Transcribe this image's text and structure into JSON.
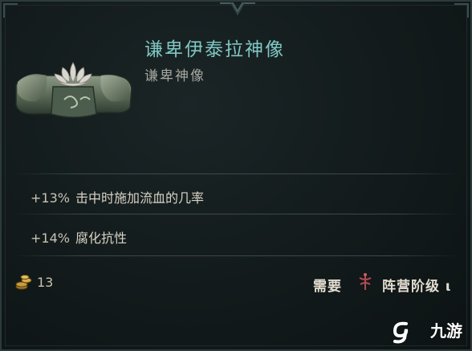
{
  "item": {
    "title": "谦卑伊泰拉神像",
    "subtitle": "谦卑神像",
    "icon": "lotus-statue-icon"
  },
  "stats": [
    {
      "value": "+13%",
      "text": "击中时施加流血的几率"
    },
    {
      "value": "+14%",
      "text": "腐化抗性"
    }
  ],
  "footer": {
    "coin_icon": "gold-coins-icon",
    "count": "13",
    "requirement_label": "需要",
    "requirement_icon": "faction-rank-icon",
    "requirement_value": "阵营阶级 ι"
  },
  "watermark": {
    "text": "九游",
    "icon": "jiuyou-logo-icon"
  },
  "colors": {
    "title": "#7fc7c3",
    "subtitle": "#a5a79f",
    "stat_text": "#d7d3c5",
    "background": "#121a1b"
  }
}
